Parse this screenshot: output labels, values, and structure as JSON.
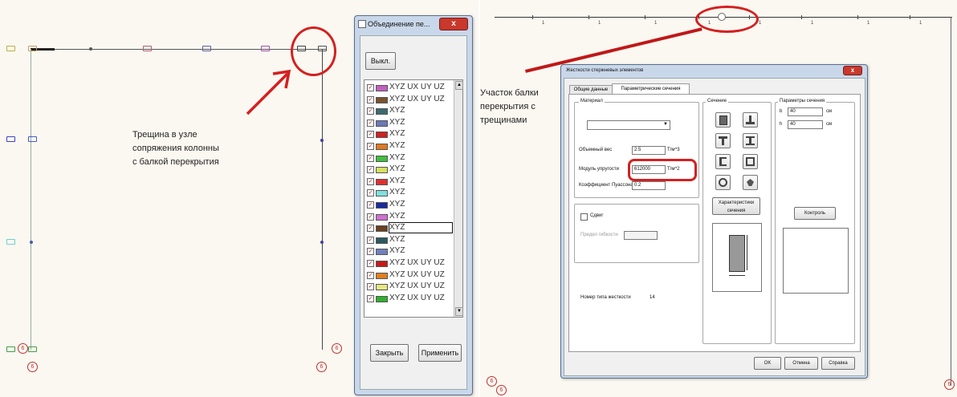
{
  "left_panel": {
    "annotation_lines": [
      "Трещина в узле",
      "сопряжения колонны",
      "с балкой перекрытия"
    ],
    "node_label": "6"
  },
  "merge_dialog": {
    "title": "Объединение пе...",
    "close_glyph": "x",
    "exit_button": "Выкл.",
    "rows": [
      {
        "color": "#c060c0",
        "label": "XYZ UX UY UZ"
      },
      {
        "color": "#7a5230",
        "label": "XYZ UX UY UZ"
      },
      {
        "color": "#3a6a70",
        "label": "XYZ"
      },
      {
        "color": "#6a78b8",
        "label": "XYZ"
      },
      {
        "color": "#d02020",
        "label": "XYZ"
      },
      {
        "color": "#e07a20",
        "label": "XYZ"
      },
      {
        "color": "#40c040",
        "label": "XYZ"
      },
      {
        "color": "#d8e060",
        "label": "XYZ"
      },
      {
        "color": "#e03030",
        "label": "XYZ"
      },
      {
        "color": "#80e0e0",
        "label": "XYZ"
      },
      {
        "color": "#1a2aa0",
        "label": "XYZ"
      },
      {
        "color": "#d070d0",
        "label": "XYZ"
      },
      {
        "color": "#6a4020",
        "label": "XYZ"
      },
      {
        "color": "#2a5a60",
        "label": "XYZ"
      },
      {
        "color": "#7080c0",
        "label": "XYZ"
      },
      {
        "color": "#c81818",
        "label": "XYZ UX UY UZ"
      },
      {
        "color": "#e08020",
        "label": "XYZ UX UY UZ"
      },
      {
        "color": "#e8e880",
        "label": "XYZ UX UY UZ"
      },
      {
        "color": "#30b030",
        "label": "XYZ UX UY UZ"
      }
    ],
    "selected_index": 12,
    "close_button": "Закрыть",
    "apply_button": "Применить"
  },
  "right_panel": {
    "annotation_lines": [
      "Участок балки",
      "перекрытия с",
      "трещинами"
    ],
    "top_ticks": [
      "1",
      "1",
      "1",
      "1",
      "1",
      "1",
      "1",
      "1"
    ],
    "node_label": "6"
  },
  "stiffness_dialog": {
    "title": "Жесткости стержневых элементов",
    "close_glyph": "x",
    "tabs": [
      "Общие данные",
      "Параметрические сечения"
    ],
    "material_label": "Материал",
    "weight_label": "Объемный вес",
    "weight_value": "2.5",
    "weight_unit": "Т/м^3",
    "modulus_label": "Модуль упругости",
    "modulus_value": "612000",
    "modulus_unit": "Т/м^2",
    "poisson_label": "Коэффициент Пуассона",
    "poisson_value": "0.2",
    "shear_label": "Сдвиг",
    "reduction_label": "Предел гибкости",
    "stiffness_number_label": "Номер типа жесткости",
    "stiffness_number": "14",
    "section_label": "Сечение",
    "params_label": "Параметры сечения",
    "b_label": "b",
    "b_value": "40",
    "b_unit": "см",
    "h_label": "h",
    "h_value": "40",
    "h_unit": "см",
    "characteristics_button": "Характеристики сечения",
    "control_button": "Контроль",
    "ok_button": "OK",
    "cancel_button": "Отмена",
    "help_button": "Справка"
  }
}
